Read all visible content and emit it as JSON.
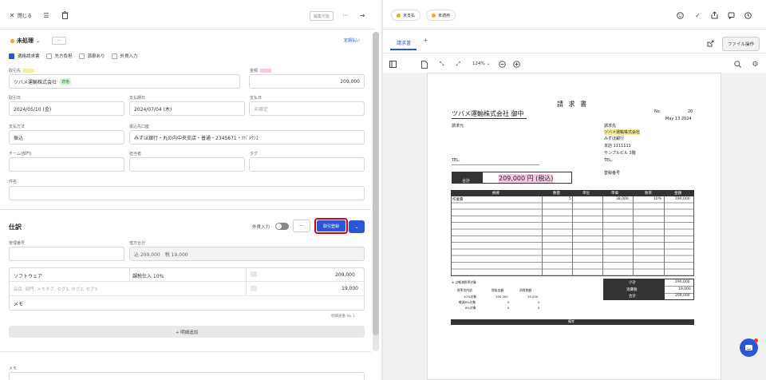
{
  "header": {
    "close_label": "閉じる",
    "edit_status": "編集可能"
  },
  "main": {
    "status": "未処理",
    "status_more": "···",
    "periodic_link": "定期払い",
    "checks": [
      {
        "label": "適格請求書",
        "checked": true
      },
      {
        "label": "先方負担",
        "checked": false
      },
      {
        "label": "源泉あり",
        "checked": false
      },
      {
        "label": "外貨入力",
        "checked": false
      }
    ],
    "partner_label": "取引先",
    "partner_value": "ツバメ運輸株式会社",
    "partner_badge": "適格",
    "amount_label": "金額",
    "amount_value": "209,000",
    "date_label": "取引日",
    "date_value": "2024/05/10 (金)",
    "due_label": "支払期日",
    "due_value": "2024/07/04 (木)",
    "paydate_label": "支払日",
    "paydate_placeholder": "未確定",
    "method_label": "支払方法",
    "method_value": "振込",
    "account_label": "振込先口座",
    "account_value": "みずほ銀行・丸の内中央支店・普通・2345671・ﾂﾊﾞﾒｳﾝﾕ",
    "team_label": "チーム(部門)",
    "owner_label": "担当者",
    "tag_label": "タグ",
    "subject_label": "件名"
  },
  "journal": {
    "title": "仕訳",
    "foreign_label": "外貨入力",
    "more": "···",
    "register_label": "取引登録",
    "mgmt_label": "管理番号",
    "total_label": "借方合計",
    "total_value": "込 209,000　税 19,000",
    "account": "ソフトウェア",
    "tax": "課税仕入 10%",
    "amount": "209,000",
    "tax_amount": "19,000",
    "detail_placeholder": "品目, 部門, メモタグ, セグ1, セグ2, セグ3",
    "memo_label": "メモ",
    "detail_note": "明細通番",
    "detail_no": "No.1",
    "add_label": "+ 明細追加",
    "memo2_label": "メモ"
  },
  "right": {
    "pill_unpaid": "未支払",
    "pill_unapplied": "未適用",
    "tab_invoice": "請求書",
    "tab_add": "+",
    "file_ops": "ファイル操作",
    "zoom": "124%",
    "zoom_caret": "⌄"
  },
  "invoice": {
    "title": "請 求 書",
    "company": "ツバメ運輸株式会社 御中",
    "no_label": "No.",
    "no_value": "20",
    "date": "May 13 2024",
    "requester": "請求元",
    "tel_left": "TEL:",
    "billto_label": "請求先",
    "billto_name": "ツバメ運輸株式会社",
    "billto_bank": "みずほ銀行",
    "billto_zip": "本店 1111111",
    "billto_bldg": "サンプルビル 3階",
    "tel_right": "TEL:",
    "reg_no": "登録番号",
    "total_label": "合計",
    "total_value": "209,000 円 (税込)",
    "table_headers": [
      "摘要",
      "数量",
      "単位",
      "単価",
      "税率",
      "金額"
    ],
    "row1": [
      "作業費",
      "5",
      "",
      "38,000",
      "10%",
      "190,000"
    ],
    "tax_note": "※ は軽減税率対象",
    "tax_headers": [
      "税率別内訳",
      "税抜金額",
      "消費税額"
    ],
    "tax_rows": [
      [
        "10%対象",
        "190,000",
        "19,000"
      ],
      [
        "軽減8%対象",
        "0",
        "0"
      ],
      [
        "8%対象",
        "0",
        "0"
      ]
    ],
    "subtotal_label": "小計",
    "subtotal_value": "190,000",
    "tax_label": "消費税",
    "tax_value": "19,000",
    "grand_label": "合計",
    "grand_value": "209,000",
    "remarks": "備考"
  },
  "colors": {
    "accent": "#2b57d6",
    "status_dot": "#e8b400",
    "register_outline": "#d0021b",
    "highlight_yellow": "#f5ef9a",
    "highlight_pink": "#f6c8e6"
  }
}
